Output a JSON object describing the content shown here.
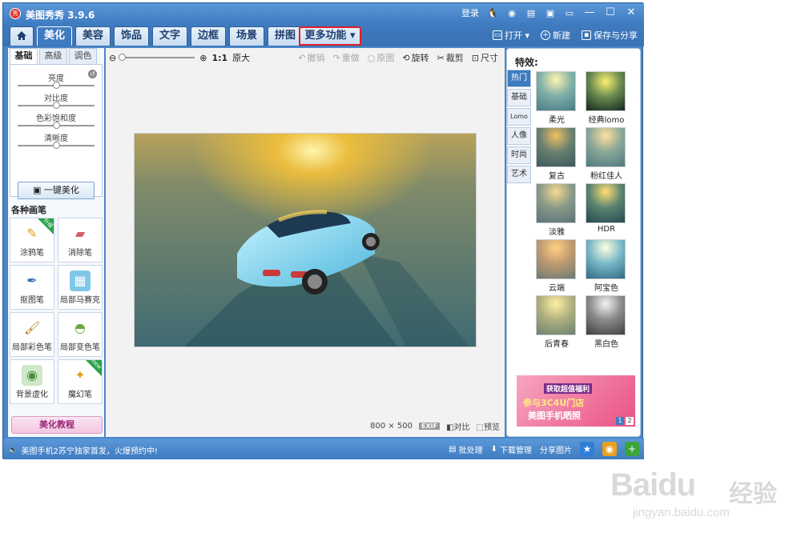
{
  "app": {
    "title": "美图秀秀 3.9.6",
    "logo_text": "秀"
  },
  "titlebar": {
    "login": "登录"
  },
  "tabs": [
    {
      "label": "美化"
    },
    {
      "label": "美容"
    },
    {
      "label": "饰品"
    },
    {
      "label": "文字"
    },
    {
      "label": "边框"
    },
    {
      "label": "场景"
    },
    {
      "label": "拼图"
    },
    {
      "label": "更多功能 ▾"
    }
  ],
  "file_actions": {
    "open": "打开 ▾",
    "new": "新建",
    "save": "保存与分享"
  },
  "left_panel": {
    "subtabs": [
      "基础",
      "高级",
      "调色"
    ],
    "sliders": [
      "亮度",
      "对比度",
      "色彩饱和度",
      "清晰度"
    ],
    "one_key": "一键美化",
    "brush_section": "各种画笔",
    "brushes": [
      {
        "label": "涂鸦笔",
        "badge": "升级"
      },
      {
        "label": "消除笔"
      },
      {
        "label": "抠图笔"
      },
      {
        "label": "局部马赛克"
      },
      {
        "label": "局部彩色笔"
      },
      {
        "label": "局部变色笔"
      },
      {
        "label": "背景虚化"
      },
      {
        "label": "魔幻笔",
        "badge": "new"
      }
    ],
    "tutorial": "美化教程"
  },
  "canvas": {
    "zoom_label": "1:1",
    "original_size": "原大",
    "tools": {
      "undo": "撤销",
      "redo": "重做",
      "original": "原图",
      "rotate": "旋转",
      "crop": "裁剪",
      "resize": "尺寸"
    },
    "dimensions": "800 × 500",
    "exif": "EXIF",
    "compare": "对比",
    "preview": "预览"
  },
  "effects_panel": {
    "title": "特效:",
    "categories": [
      "热门",
      "基础",
      "Lomo",
      "人像",
      "时尚",
      "艺术"
    ],
    "effects": [
      {
        "label": "柔光"
      },
      {
        "label": "经典lomo"
      },
      {
        "label": "复古"
      },
      {
        "label": "粉红佳人"
      },
      {
        "label": "淡雅"
      },
      {
        "label": "HDR"
      },
      {
        "label": "云端"
      },
      {
        "label": "阿宝色"
      },
      {
        "label": "后青春"
      },
      {
        "label": "黑白色"
      }
    ],
    "ad": {
      "line1": "获取超值福利",
      "line2": "参与3C4U门店",
      "line3": "美图手机晒照",
      "pages": [
        "1",
        "2"
      ]
    }
  },
  "statusbar": {
    "news": "美图手机2苏宁独家首发，火爆预约中!",
    "batch": "批处理",
    "download": "下载管理",
    "share": "分享图片"
  },
  "watermark": {
    "brand": "Baidu",
    "cn": "经验",
    "url": "jingyan.baidu.com"
  }
}
